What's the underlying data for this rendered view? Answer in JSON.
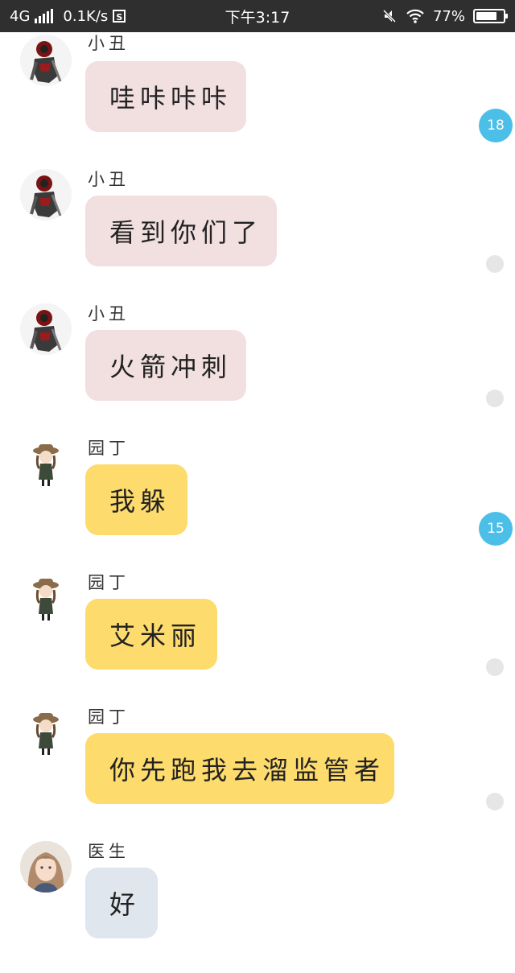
{
  "status_bar": {
    "network": "4G",
    "speed": "0.1K/s",
    "time": "下午3:17",
    "battery": "77%",
    "battery_level": 0.77
  },
  "messages": [
    {
      "sender": "小丑",
      "text": "哇咔咔咔",
      "role": "joker",
      "badge": "18"
    },
    {
      "sender": "小丑",
      "text": "看到你们了",
      "role": "joker",
      "badge": ""
    },
    {
      "sender": "小丑",
      "text": "火箭冲刺",
      "role": "joker",
      "badge": ""
    },
    {
      "sender": "园丁",
      "text": "我躲",
      "role": "gardener",
      "badge": "15"
    },
    {
      "sender": "园丁",
      "text": "艾米丽",
      "role": "gardener",
      "badge": ""
    },
    {
      "sender": "园丁",
      "text": "你先跑我去溜监管者",
      "role": "gardener",
      "badge": ""
    },
    {
      "sender": "医生",
      "text": "好",
      "role": "doctor",
      "badge": ""
    }
  ],
  "colors": {
    "joker_bubble": "#f2dfe0",
    "gardener_bubble": "#fddb6c",
    "doctor_bubble": "#dfe6ee",
    "badge": "#4cbfe9"
  }
}
